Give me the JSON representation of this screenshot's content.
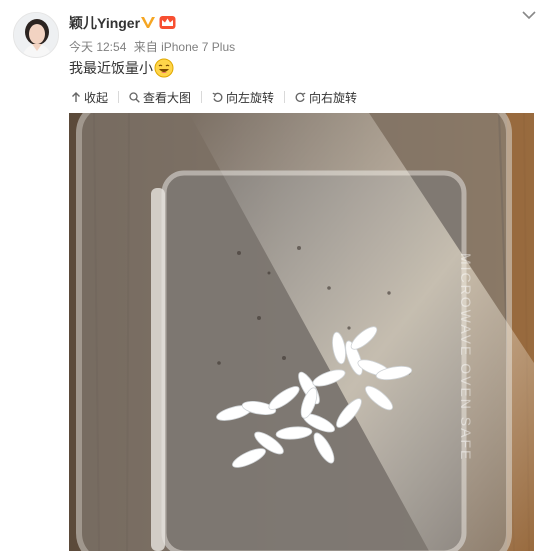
{
  "post": {
    "username": "颖儿Yinger",
    "meta": {
      "time": "今天 12:54",
      "from_label": "来自",
      "device": "iPhone 7 Plus"
    },
    "text": "我最近饭量小",
    "emoji": "laughing-emoji"
  },
  "toolbar": {
    "collapse": "收起",
    "view_large": "查看大图",
    "rotate_left": "向左旋转",
    "rotate_right": "向右旋转"
  },
  "photo": {
    "embossed_text": "MICROWAVE OVEN SAFE"
  },
  "colors": {
    "text": "#333333",
    "meta": "#808080",
    "badge_v": "#f5a623",
    "badge_member": "#f74f31"
  }
}
